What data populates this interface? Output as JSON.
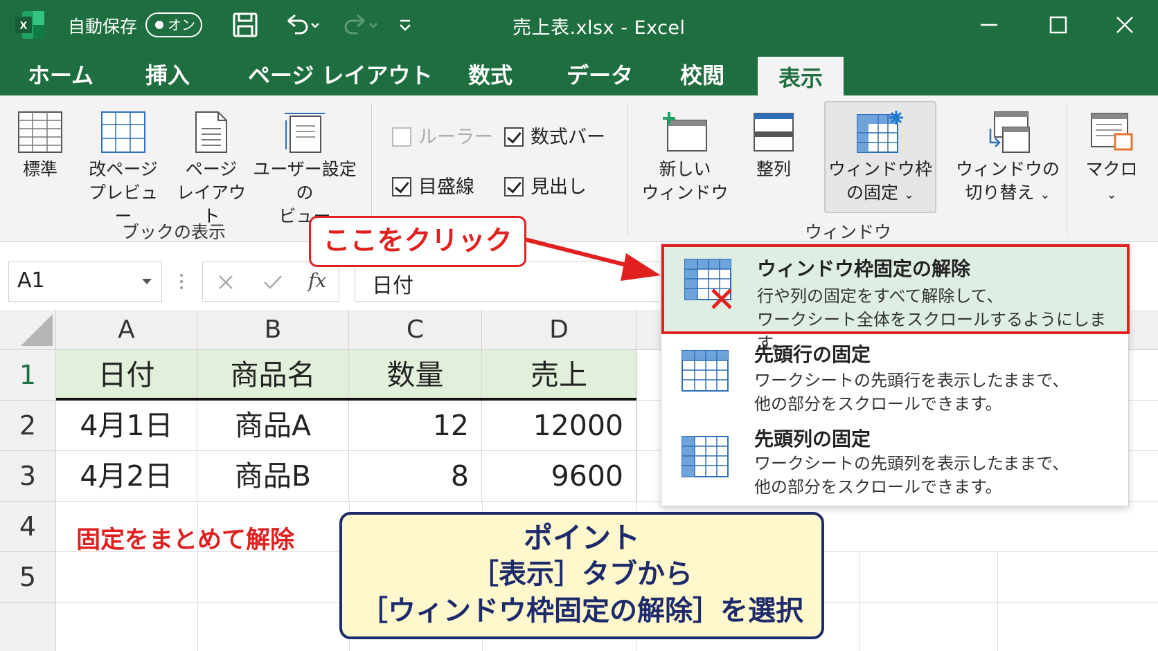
{
  "titlebar": {
    "app_icon": "excel-logo-icon",
    "autosave_label": "自動保存",
    "autosave_toggle": "オン",
    "window_title": "売上表.xlsx - Excel"
  },
  "tabs": [
    "ホーム",
    "挿入",
    "ページ レイアウト",
    "数式",
    "データ",
    "校閲",
    "表示"
  ],
  "active_tab": "表示",
  "ribbon": {
    "book_view": {
      "group_label": "ブックの表示",
      "normal": "標準",
      "page_break_1": "改ページ",
      "page_break_2": "プレビュー",
      "page_layout_1": "ページ",
      "page_layout_2": "レイアウト",
      "custom_view_1": "ユーザー設定の",
      "custom_view_2": "ビュー"
    },
    "show": {
      "ruler": "ルーラー",
      "gridlines": "目盛線",
      "formula_bar": "数式バー",
      "headings": "見出し"
    },
    "window": {
      "group_label": "ウィンドウ",
      "new_window_1": "新しい",
      "new_window_2": "ウィンドウ",
      "arrange": "整列",
      "freeze_1": "ウィンドウ枠",
      "freeze_2": "の固定",
      "switch_1": "ウィンドウの",
      "switch_2": "切り替え"
    },
    "macros": "マクロ"
  },
  "formula_bar": {
    "name_box": "A1",
    "fx_symbol": "fx",
    "content": "日付"
  },
  "sheet": {
    "columns": [
      "A",
      "B",
      "C",
      "D"
    ],
    "rows": [
      "1",
      "2",
      "3",
      "4",
      "5"
    ],
    "header": [
      "日付",
      "商品名",
      "数量",
      "売上"
    ],
    "data": [
      [
        "4月1日",
        "商品A",
        "12",
        "12000"
      ],
      [
        "4月2日",
        "商品B",
        "8",
        "9600"
      ]
    ]
  },
  "menu": {
    "unfreeze_title": "ウィンドウ枠固定の解除",
    "unfreeze_desc_1": "行や列の固定をすべて解除して、",
    "unfreeze_desc_2": "ワークシート全体をスクロールするようにします。",
    "freeze_row_title": "先頭行の固定",
    "freeze_row_desc_1": "ワークシートの先頭行を表示したままで、",
    "freeze_row_desc_2": "他の部分をスクロールできます。",
    "freeze_col_title": "先頭列の固定",
    "freeze_col_desc_1": "ワークシートの先頭列を表示したままで、",
    "freeze_col_desc_2": "他の部分をスクロールできます。"
  },
  "annotations": {
    "click_here": "ここをクリック",
    "red_note": "固定をまとめて解除",
    "point_title": "ポイント",
    "point_line2": "［表示］タブから",
    "point_line3": "［ウィンドウ枠固定の解除］を選択"
  },
  "colors": {
    "excel_green": "#1e6e3f",
    "header_fill": "#e2efda",
    "accent_red": "#e0211f",
    "note_navy": "#1d2a6b",
    "note_fill": "#fff8cc"
  }
}
